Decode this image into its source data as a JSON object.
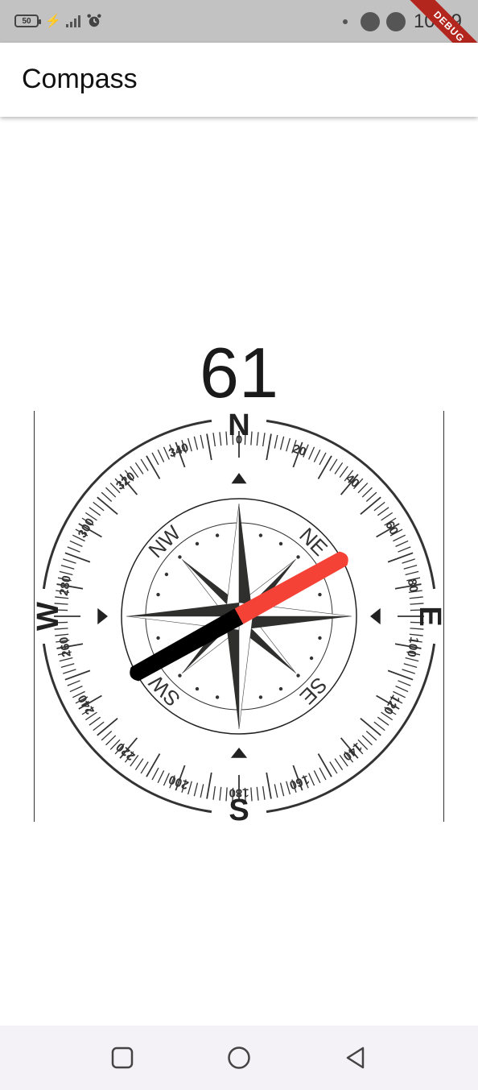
{
  "status_bar": {
    "battery_level": "50",
    "clock": "10:19",
    "debug_label": "DEBUG",
    "icons": [
      "battery-icon",
      "charging-icon",
      "signal-icon",
      "alarm-icon",
      "notification-dot-icon",
      "circle-icon",
      "circle-icon"
    ]
  },
  "app_bar": {
    "title": "Compass"
  },
  "heading": {
    "degrees": "61"
  },
  "compass": {
    "cardinal": {
      "north": "N",
      "east": "E",
      "south": "S",
      "west": "W"
    },
    "intercardinal": {
      "northeast": "NE",
      "southeast": "SE",
      "southwest": "SW",
      "northwest": "NW"
    },
    "degree_labels": [
      "0",
      "20",
      "40",
      "60",
      "80",
      "100",
      "120",
      "140",
      "160",
      "180",
      "200",
      "220",
      "240",
      "260",
      "280",
      "300",
      "320",
      "340"
    ],
    "needle_colors": {
      "north": "#f44336",
      "south": "#000000"
    }
  },
  "nav_bar": {
    "buttons": [
      "recent-apps-icon",
      "home-icon",
      "back-icon"
    ]
  }
}
